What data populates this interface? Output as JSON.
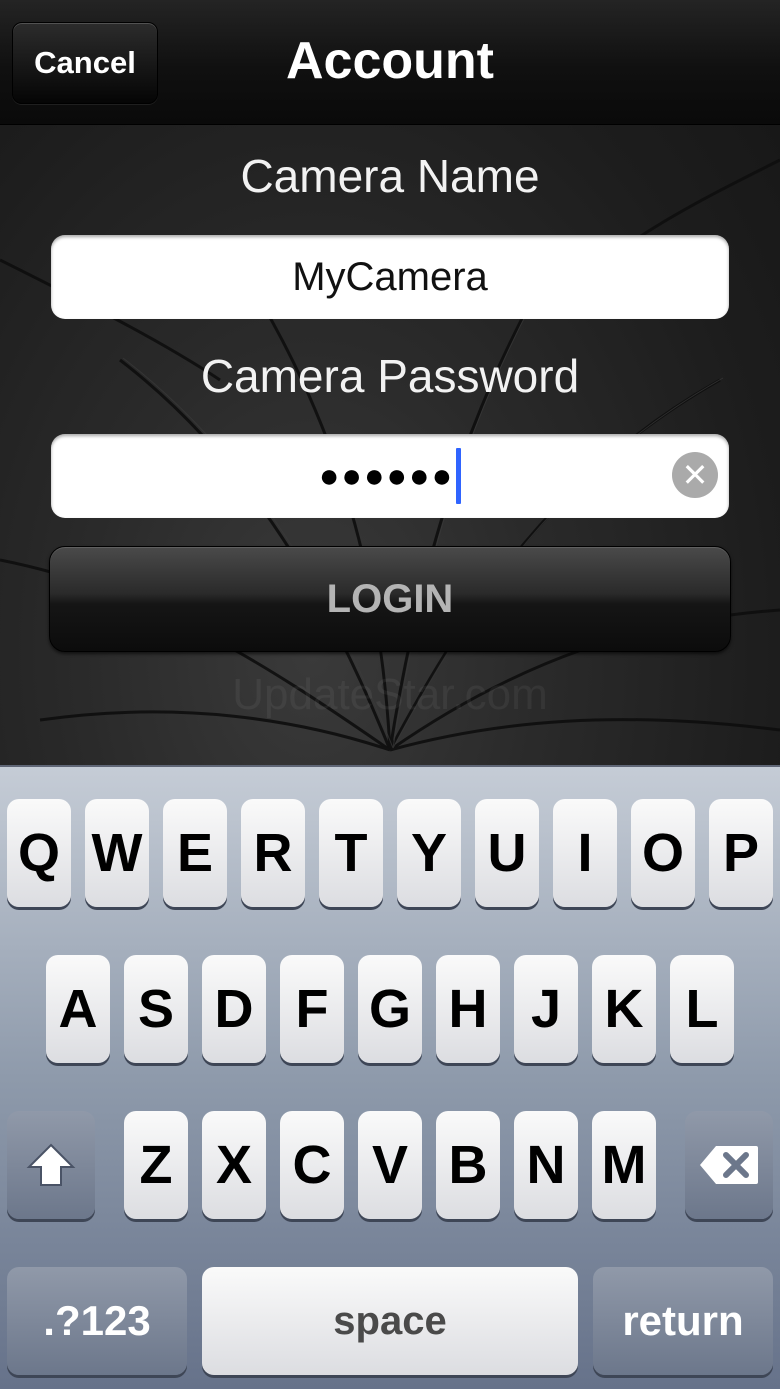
{
  "navbar": {
    "cancel_label": "Cancel",
    "title": "Account"
  },
  "form": {
    "camera_name_label": "Camera Name",
    "camera_name_value": "MyCamera",
    "camera_password_label": "Camera Password",
    "camera_password_masked": "●●●●●●",
    "login_label": "LOGIN"
  },
  "watermark": "UpdateStar.com",
  "keyboard": {
    "row1": [
      "Q",
      "W",
      "E",
      "R",
      "T",
      "Y",
      "U",
      "I",
      "O",
      "P"
    ],
    "row2": [
      "A",
      "S",
      "D",
      "F",
      "G",
      "H",
      "J",
      "K",
      "L"
    ],
    "row3": [
      "Z",
      "X",
      "C",
      "V",
      "B",
      "N",
      "M"
    ],
    "numbers_label": ".?123",
    "space_label": "space",
    "return_label": "return"
  },
  "colors": {
    "caret": "#2f64ff",
    "keyboard_bg": "#8e9aab"
  }
}
